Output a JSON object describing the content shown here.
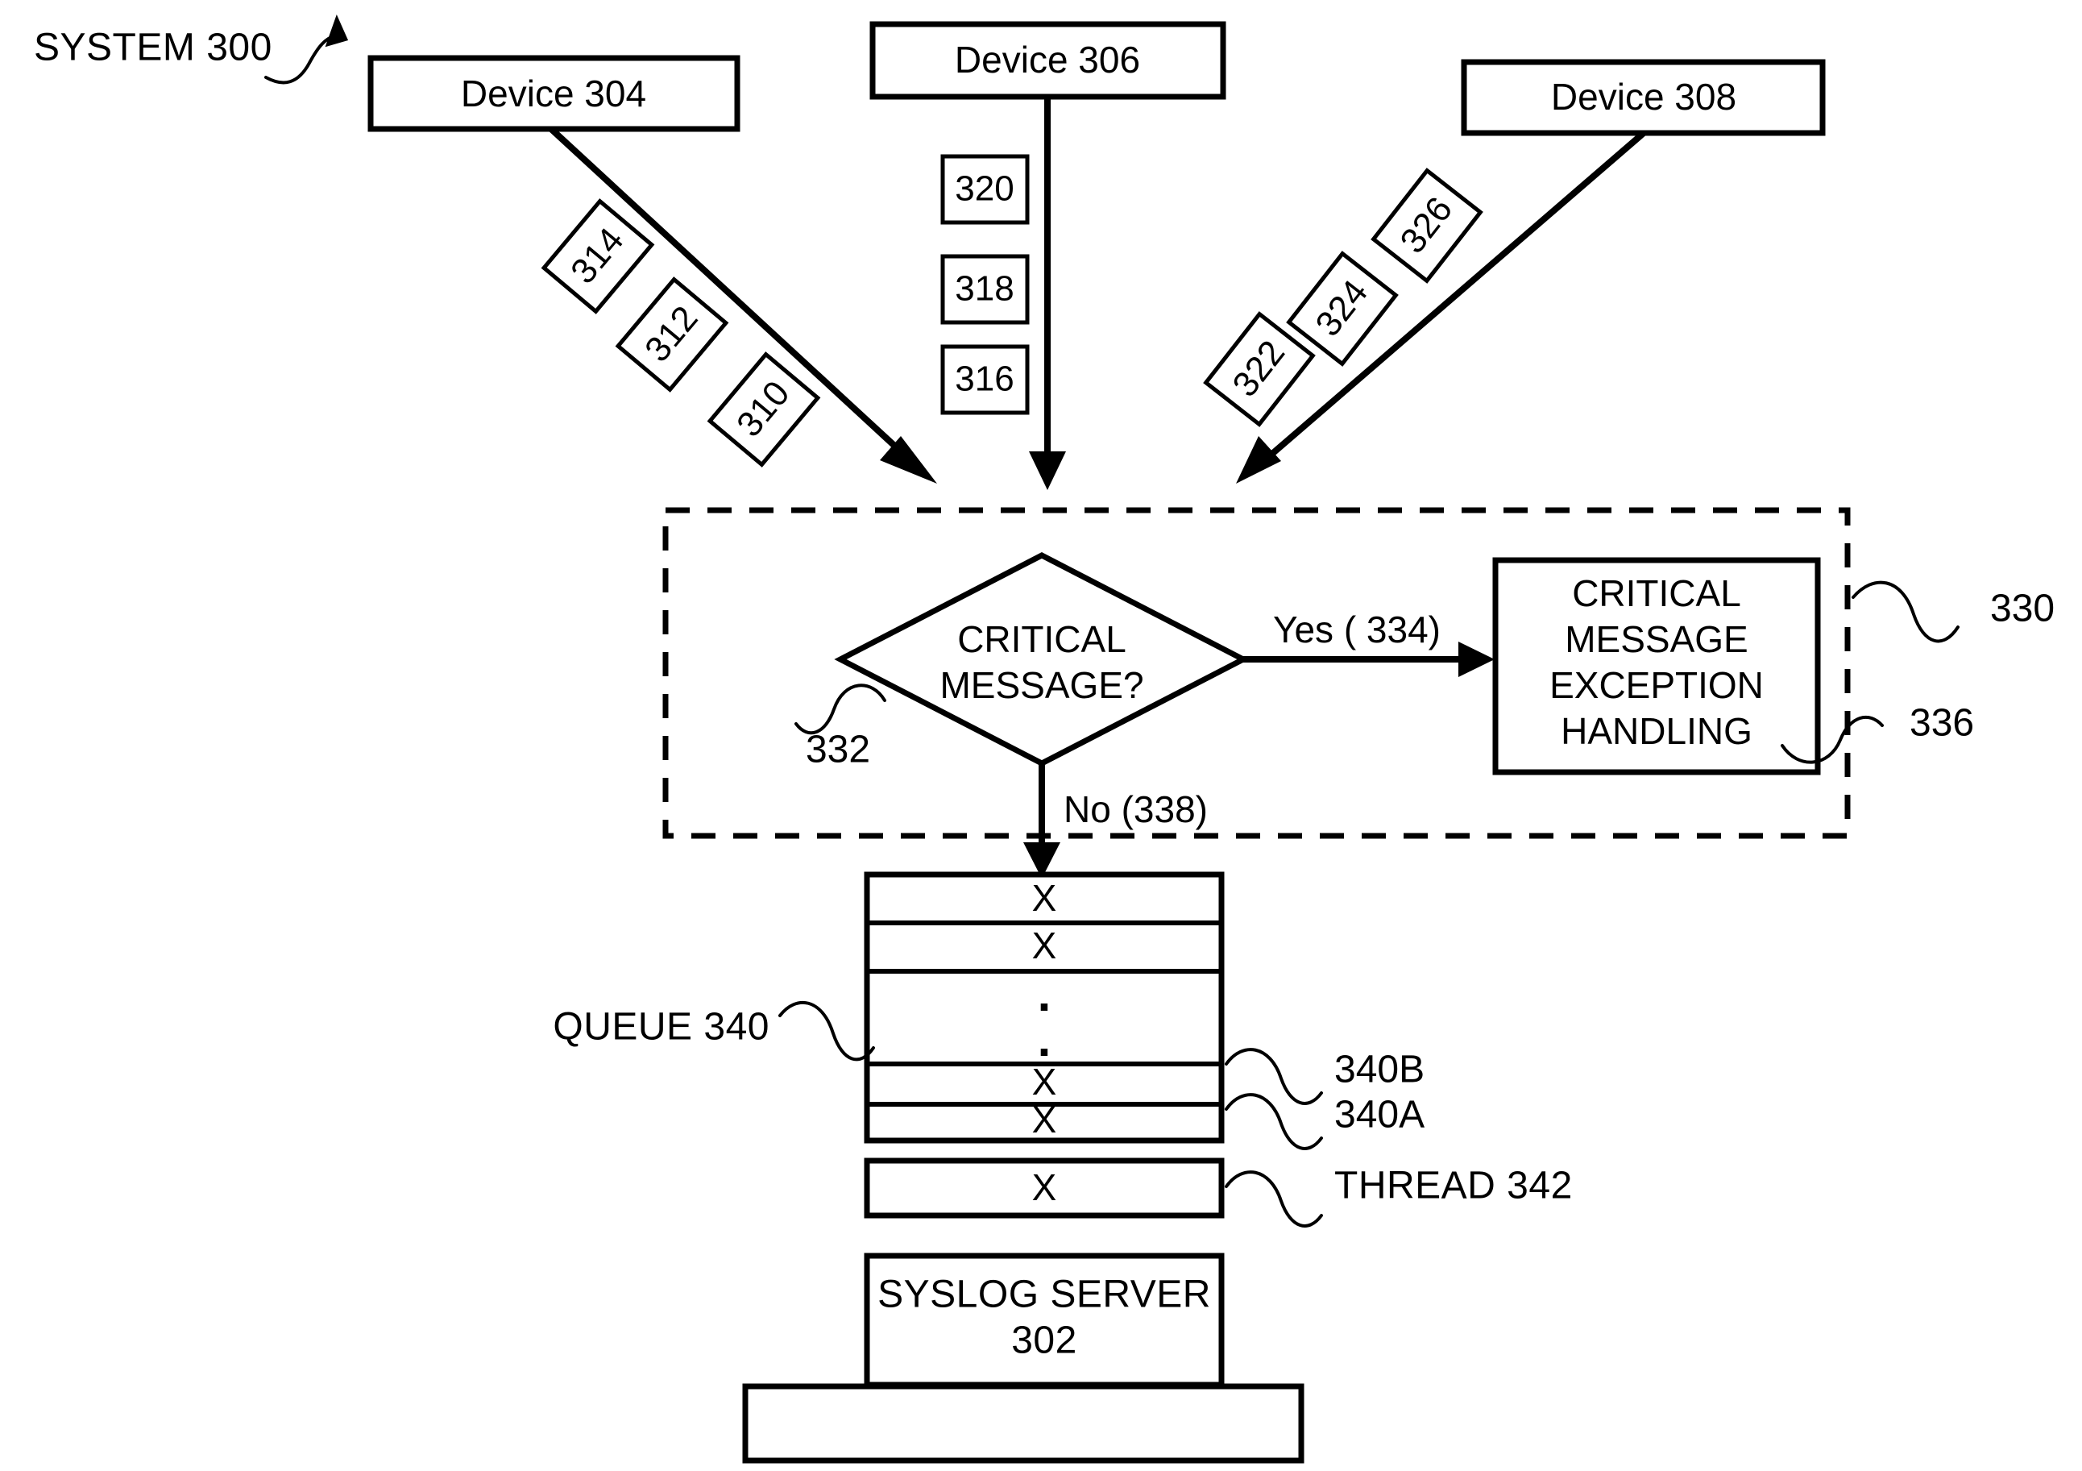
{
  "figure": {
    "title": "SYSTEM 300",
    "background_color": "#ffffff",
    "line_color": "#000000"
  },
  "devices": [
    {
      "label": "Device 304",
      "name": "device-304"
    },
    {
      "label": "Device 306",
      "name": "device-306"
    },
    {
      "label": "Device 308",
      "name": "device-308"
    }
  ],
  "message_labels": {
    "left_diagonal": [
      "314",
      "312",
      "310"
    ],
    "center_stack": [
      "320",
      "318",
      "316"
    ],
    "right_diagonal": [
      "322",
      "324",
      "326"
    ]
  },
  "exception_region": {
    "ref": "330",
    "decision": {
      "line1": "CRITICAL",
      "line2": "MESSAGE?",
      "ref": "332"
    },
    "yes_branch_label": "Yes ( 334)",
    "no_branch_label": "No (338)",
    "handler": {
      "line1": "CRITICAL",
      "line2": "MESSAGE",
      "line3": "EXCEPTION",
      "line4": "HANDLING",
      "ref": "336"
    }
  },
  "queue": {
    "label": "QUEUE 340",
    "rows": [
      {
        "mark": "X",
        "kind": "entry"
      },
      {
        "mark": "X",
        "kind": "entry"
      },
      {
        "mark": "",
        "kind": "ellipsis"
      },
      {
        "mark": "X",
        "kind": "entry",
        "ref": "340B"
      },
      {
        "mark": "X",
        "kind": "entry",
        "ref": "340A"
      }
    ],
    "ellipsis_dots": [
      ".",
      "."
    ],
    "ref_upper": "340B",
    "ref_lower": "340A"
  },
  "thread": {
    "mark": "X",
    "label": "THREAD 342"
  },
  "server": {
    "line1": "SYSLOG SERVER",
    "line2": "302"
  },
  "base_plate": {
    "label": ""
  }
}
